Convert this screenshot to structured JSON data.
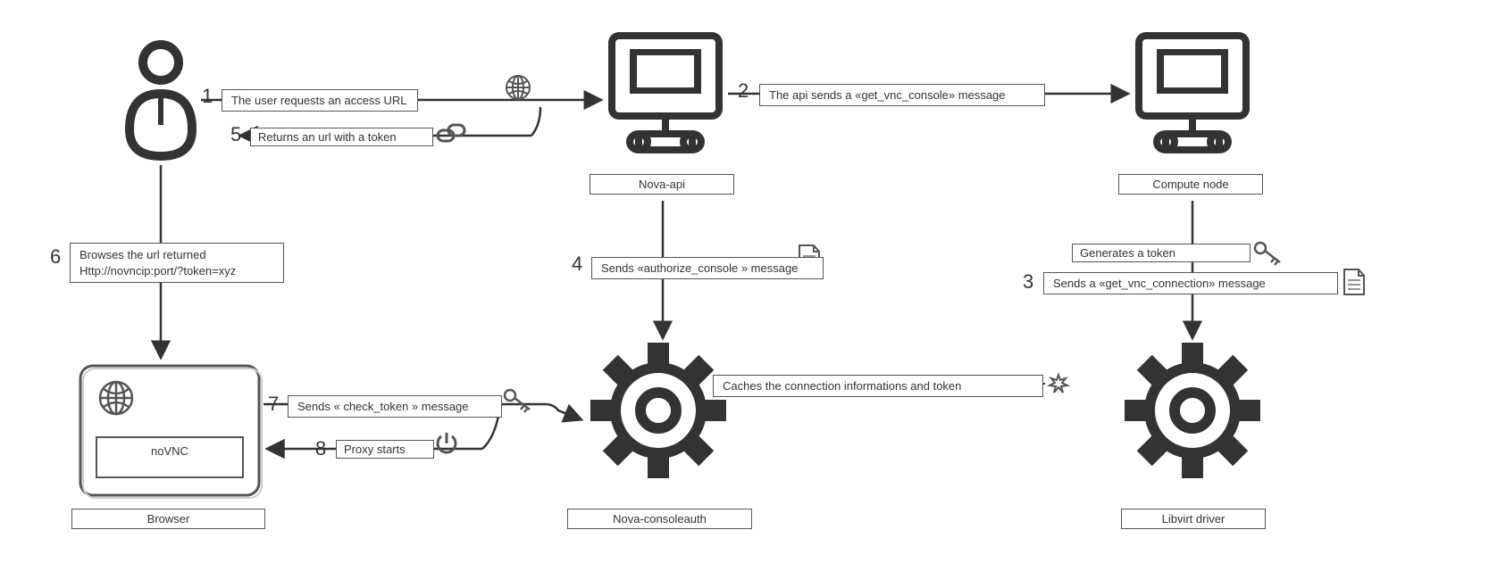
{
  "nodes": {
    "user": "User",
    "nova_api": "Nova-api",
    "compute_node": "Compute node",
    "browser": "Browser",
    "novnc": "noVNC",
    "nova_consoleauth": "Nova-consoleauth",
    "libvirt_driver": "Libvirt driver"
  },
  "steps": {
    "s1": {
      "n": "1",
      "text": "The user requests an access URL"
    },
    "s2": {
      "n": "2",
      "text": "The api sends a «get_vnc_console» message"
    },
    "s3_top": {
      "text": "Generates a token"
    },
    "s3": {
      "n": "3",
      "text": "Sends a «get_vnc_connection» message"
    },
    "s4": {
      "n": "4",
      "text": "Sends «authorize_console » message"
    },
    "s5": {
      "n": "5",
      "text": "Returns an url with a token"
    },
    "s6": {
      "n": "6",
      "text_l1": "Browses the url returned",
      "text_l2": "Http://novncip:port/?token=xyz"
    },
    "s7": {
      "n": "7",
      "text": "Sends « check_token » message"
    },
    "s8": {
      "n": "8",
      "text": "Proxy starts"
    },
    "cache": {
      "text": "Caches the connection informations and token"
    }
  }
}
